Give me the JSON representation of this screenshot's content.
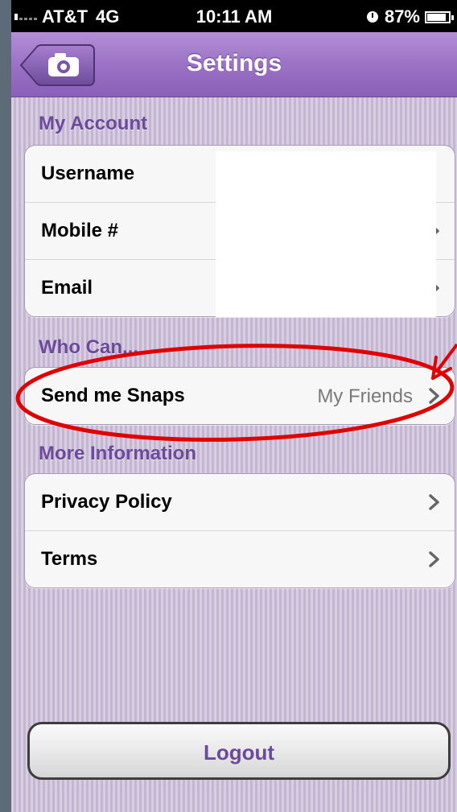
{
  "status_bar": {
    "carrier": "AT&T",
    "network": "4G",
    "time": "10:11 AM",
    "battery": "87%",
    "battery_level": 0.87
  },
  "nav": {
    "title": "Settings",
    "back_icon": "camera-icon"
  },
  "sections": {
    "account": {
      "header": "My Account",
      "rows": [
        {
          "label": "Username",
          "value": ""
        },
        {
          "label": "Mobile #",
          "value": ""
        },
        {
          "label": "Email",
          "value": ""
        }
      ]
    },
    "who_can": {
      "header": "Who Can...",
      "rows": [
        {
          "label": "Send me Snaps",
          "value": "My Friends"
        }
      ]
    },
    "more_info": {
      "header": "More Information",
      "rows": [
        {
          "label": "Privacy Policy"
        },
        {
          "label": "Terms"
        }
      ]
    }
  },
  "logout": {
    "label": "Logout"
  },
  "colors": {
    "accent": "#6b4a9c",
    "nav": "#9b72c6",
    "annotation": "#e00000"
  }
}
